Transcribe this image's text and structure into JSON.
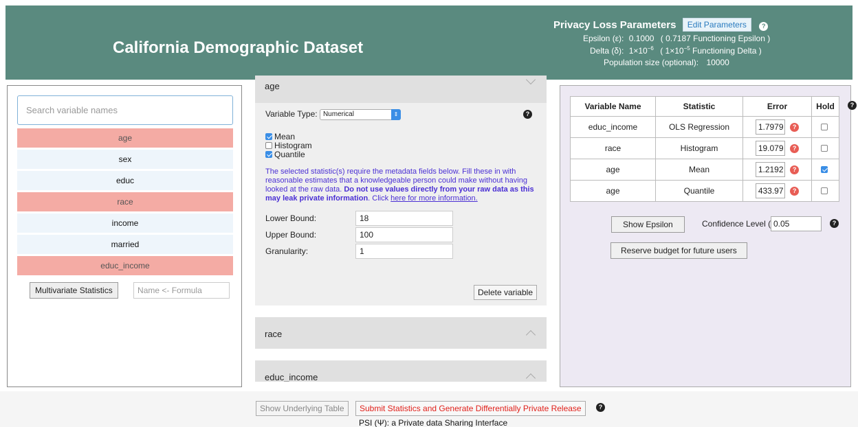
{
  "header": {
    "title": "California Demographic Dataset",
    "privacy_title": "Privacy Loss Parameters",
    "edit_label": "Edit Parameters",
    "epsilon_label": "Epsilon (ε):",
    "epsilon_value": "0.1000",
    "epsilon_functioning": "( 0.7187 Functioning Epsilon )",
    "delta_label": "Delta (δ):",
    "delta_base": "1×10",
    "delta_exp": "−6",
    "delta_func_pre": "( 1×10",
    "delta_func_exp": "−5",
    "delta_func_post": " Functioning Delta )",
    "population_label": "Population size (optional):",
    "population_value": "10000"
  },
  "left": {
    "search_placeholder": "Search variable names",
    "variables": [
      {
        "name": "age",
        "selected": true
      },
      {
        "name": "sex",
        "selected": false
      },
      {
        "name": "educ",
        "selected": false
      },
      {
        "name": "race",
        "selected": true
      },
      {
        "name": "income",
        "selected": false
      },
      {
        "name": "married",
        "selected": false
      },
      {
        "name": "educ_income",
        "selected": true
      }
    ],
    "multivariate_label": "Multivariate Statistics",
    "formula_placeholder": "Name <- Formula"
  },
  "middle": {
    "open_card": {
      "name": "age",
      "variable_type_label": "Variable Type:",
      "variable_type_value": "Numerical",
      "statistics": [
        {
          "label": "Mean",
          "checked": true
        },
        {
          "label": "Histogram",
          "checked": false
        },
        {
          "label": "Quantile",
          "checked": true
        }
      ],
      "info_text_1": "The selected statistic(s) require the metadata fields below. Fill these in with reasonable estimates that a knowledgeable person could make without having looked at the raw data. ",
      "info_bold": "Do not use values directly from your raw data as this may leak private information",
      "info_text_2": ". Click ",
      "info_link": "here for more information.",
      "lower_label": "Lower Bound:",
      "lower_value": "18",
      "upper_label": "Upper Bound:",
      "upper_value": "100",
      "gran_label": "Granularity:",
      "gran_value": "1",
      "delete_label": "Delete variable"
    },
    "closed_cards": [
      "race",
      "educ_income"
    ]
  },
  "right": {
    "headers": [
      "Variable Name",
      "Statistic",
      "Error",
      "Hold"
    ],
    "rows": [
      {
        "variable": "educ_income",
        "statistic": "OLS Regression",
        "error": "1.7979",
        "hold": false
      },
      {
        "variable": "race",
        "statistic": "Histogram",
        "error": "19.079",
        "hold": false
      },
      {
        "variable": "age",
        "statistic": "Mean",
        "error": "1.2192",
        "hold": true
      },
      {
        "variable": "age",
        "statistic": "Quantile",
        "error": "433.97",
        "hold": false
      }
    ],
    "show_epsilon_label": "Show Epsilon",
    "confidence_label": "Confidence Level (α)",
    "confidence_value": "0.05",
    "reserve_label": "Reserve budget for future users"
  },
  "footer": {
    "show_table_label": "Show Underlying Table",
    "submit_label": "Submit Statistics and Generate Differentially Private Release",
    "credit": "PSI (Ψ): a Private data Sharing Interface"
  },
  "colors": {
    "header_bg": "#5a8a7f",
    "selected_var": "#f4aba4",
    "unselected_var": "#eef5fb",
    "right_panel_bg": "#ede9f3",
    "submit_text": "#e0201a",
    "info_text": "#4a2fd4"
  },
  "icons": [
    "help-icon",
    "chevron-down-icon",
    "chevron-up-icon",
    "select-arrow-icon",
    "checkbox-icon"
  ]
}
